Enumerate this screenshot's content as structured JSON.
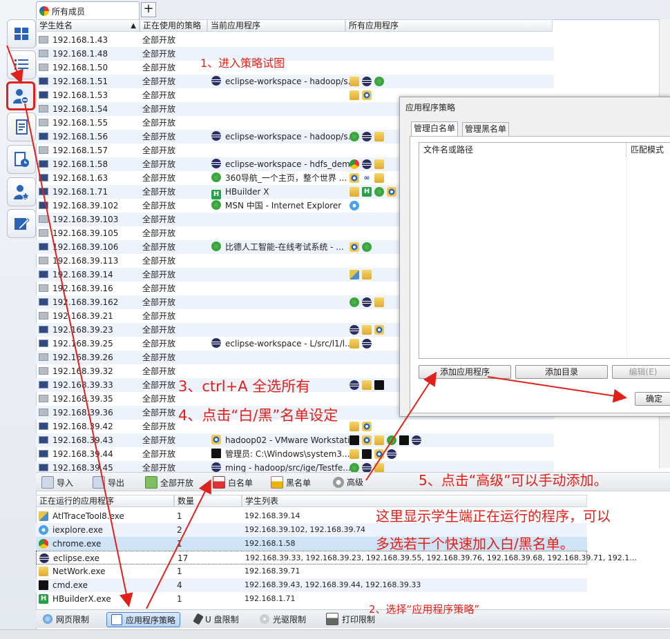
{
  "tabs": {
    "active_label": "所有成员",
    "add_label": "+"
  },
  "table": {
    "headers": [
      "学生姓名",
      "正在使用的策略",
      "当前应用程序",
      "所有应用程序"
    ],
    "rows": [
      {
        "ip": "192.168.1.43",
        "policy": "全部开放",
        "app": "",
        "app_icon": "",
        "all": [],
        "on": false
      },
      {
        "ip": "192.168.1.48",
        "policy": "全部开放",
        "app": "",
        "app_icon": "",
        "all": [],
        "on": false
      },
      {
        "ip": "192.168.1.50",
        "policy": "全部开放",
        "app": "",
        "app_icon": "",
        "all": [],
        "on": false
      },
      {
        "ip": "192.168.1.51",
        "policy": "全部开放",
        "app": "eclipse-workspace - hadoop/s...",
        "app_icon": "eclipse",
        "all": [
          "folder",
          "eclipse",
          "edge"
        ],
        "on": true
      },
      {
        "ip": "192.168.1.53",
        "policy": "全部开放",
        "app": "",
        "app_icon": "",
        "all": [
          "folder",
          "target"
        ],
        "on": true
      },
      {
        "ip": "192.168.1.54",
        "policy": "全部开放",
        "app": "",
        "app_icon": "",
        "all": [],
        "on": false
      },
      {
        "ip": "192.168.1.55",
        "policy": "全部开放",
        "app": "",
        "app_icon": "",
        "all": [],
        "on": false
      },
      {
        "ip": "192.168.1.56",
        "policy": "全部开放",
        "app": "eclipse-workspace - hadoop/s...",
        "app_icon": "eclipse",
        "all": [
          "edge",
          "eclipse",
          "folder"
        ],
        "on": true
      },
      {
        "ip": "192.168.1.57",
        "policy": "全部开放",
        "app": "",
        "app_icon": "",
        "all": [],
        "on": false
      },
      {
        "ip": "192.168.1.58",
        "policy": "全部开放",
        "app": "eclipse-workspace - hdfs_dem...",
        "app_icon": "eclipse",
        "all": [
          "chrome",
          "eclipse",
          "folder"
        ],
        "on": true
      },
      {
        "ip": "192.168.1.63",
        "policy": "全部开放",
        "app": "360导航_一个主页，整个世界 ...",
        "app_icon": "edge",
        "all": [
          "target",
          "infinity",
          "folder"
        ],
        "on": true
      },
      {
        "ip": "192.168.1.71",
        "policy": "全部开放",
        "app": "HBuilder X",
        "app_icon": "hbuilder",
        "all": [
          "folder",
          "hbuilder",
          "edge",
          "target"
        ],
        "on": true
      },
      {
        "ip": "192.168.39.102",
        "policy": "全部开放",
        "app": "MSN 中国 - Internet Explorer",
        "app_icon": "edge",
        "all": [
          "ie"
        ],
        "on": true
      },
      {
        "ip": "192.168.39.103",
        "policy": "全部开放",
        "app": "",
        "app_icon": "",
        "all": [],
        "on": false
      },
      {
        "ip": "192.168.39.105",
        "policy": "全部开放",
        "app": "",
        "app_icon": "",
        "all": [],
        "on": false
      },
      {
        "ip": "192.168.39.106",
        "policy": "全部开放",
        "app": "比德人工智能-在线考试系统 - ...",
        "app_icon": "edge",
        "all": [
          "target",
          "edge"
        ],
        "on": true
      },
      {
        "ip": "192.168.39.113",
        "policy": "全部开放",
        "app": "",
        "app_icon": "",
        "all": [],
        "on": false
      },
      {
        "ip": "192.168.39.14",
        "policy": "全部开放",
        "app": "",
        "app_icon": "",
        "all": [
          "tool",
          "folder"
        ],
        "on": true
      },
      {
        "ip": "192.168.39.16",
        "policy": "全部开放",
        "app": "",
        "app_icon": "",
        "all": [],
        "on": false
      },
      {
        "ip": "192.168.39.162",
        "policy": "全部开放",
        "app": "",
        "app_icon": "",
        "all": [
          "edge",
          "eclipse",
          "folder"
        ],
        "on": true
      },
      {
        "ip": "192.168.39.21",
        "policy": "全部开放",
        "app": "",
        "app_icon": "",
        "all": [],
        "on": false
      },
      {
        "ip": "192.168.39.23",
        "policy": "全部开放",
        "app": "",
        "app_icon": "",
        "all": [
          "eclipse",
          "folder",
          "target"
        ],
        "on": true
      },
      {
        "ip": "192.168.39.25",
        "policy": "全部开放",
        "app": "eclipse-workspace - L/src/l1/l...",
        "app_icon": "eclipse",
        "all": [
          "folder",
          "eclipse"
        ],
        "on": true
      },
      {
        "ip": "192.168.39.26",
        "policy": "全部开放",
        "app": "",
        "app_icon": "",
        "all": [],
        "on": false
      },
      {
        "ip": "192.168.39.32",
        "policy": "全部开放",
        "app": "",
        "app_icon": "",
        "all": [],
        "on": false
      },
      {
        "ip": "192.168.39.33",
        "policy": "全部开放",
        "app": "",
        "app_icon": "",
        "all": [
          "eclipse",
          "folder",
          "cmd"
        ],
        "on": true
      },
      {
        "ip": "192.168.39.35",
        "policy": "全部开放",
        "app": "",
        "app_icon": "",
        "all": [],
        "on": false
      },
      {
        "ip": "192.168.39.36",
        "policy": "全部开放",
        "app": "",
        "app_icon": "",
        "all": [],
        "on": false
      },
      {
        "ip": "192.168.39.42",
        "policy": "全部开放",
        "app": "",
        "app_icon": "",
        "all": [
          "folder",
          "target"
        ],
        "on": true
      },
      {
        "ip": "192.168.39.43",
        "policy": "全部开放",
        "app": "hadoop02 - VMware Workstati...",
        "app_icon": "target",
        "all": [
          "cmd",
          "target",
          "folder",
          "edge",
          "cmd",
          "eclipse"
        ],
        "on": true
      },
      {
        "ip": "192.168.39.44",
        "policy": "全部开放",
        "app": "管理员: C:\\Windows\\system3...",
        "app_icon": "cmd",
        "all": [
          "folder",
          "cmd",
          "target",
          "eclipse"
        ],
        "on": true
      },
      {
        "ip": "192.168.39.45",
        "policy": "全部开放",
        "app": "ming - hadoop/src/ige/Testfe...",
        "app_icon": "eclipse",
        "all": [
          "edge",
          "eclipse",
          "folder"
        ],
        "on": true
      }
    ]
  },
  "toolbar": {
    "import": "导入",
    "export": "导出",
    "open_all": "全部开放",
    "whitelist": "白名单",
    "blacklist": "黑名单",
    "advanced": "高级"
  },
  "running": {
    "headers": [
      "正在运行的应用程序",
      "数量",
      "学生列表"
    ],
    "rows": [
      {
        "name": "AtlTraceTool8.exe",
        "count": "1",
        "students": "192.168.39.14",
        "icon": "tool"
      },
      {
        "name": "iexplore.exe",
        "count": "2",
        "students": "192.168.39.102, 192.168.39.74",
        "icon": "ie"
      },
      {
        "name": "chrome.exe",
        "count": "1",
        "students": "192.168.1.58",
        "icon": "chrome"
      },
      {
        "name": "eclipse.exe",
        "count": "17",
        "students": "192.168.39.33, 192.168.39.23, 192.168.39.55, 192.168.39.76, 192.168.39.68, 192.168.39.71, 192.1...",
        "icon": "eclipse"
      },
      {
        "name": "NetWork.exe",
        "count": "1",
        "students": "192.168.39.71",
        "icon": "network"
      },
      {
        "name": "cmd.exe",
        "count": "4",
        "students": "192.168.39.43, 192.168.39.44, 192.168.39.33",
        "icon": "cmd"
      },
      {
        "name": "HBuilderX.exe",
        "count": "1",
        "students": "192.168.1.71",
        "icon": "hbuilder"
      }
    ]
  },
  "bottom_tabs": [
    "网页限制",
    "应用程序策略",
    "U 盘限制",
    "光驱限制",
    "打印限制"
  ],
  "dialog": {
    "title": "应用程序策略",
    "tab_white": "管理白名单",
    "tab_black": "管理黑名单",
    "col_path": "文件名或路径",
    "col_match": "匹配模式",
    "add_app": "添加应用程序",
    "add_dir": "添加目录",
    "edit": "编辑(E)",
    "ok": "确定"
  },
  "annotations": {
    "a1": "1、进入策略试图",
    "a2": "2、选择“应用程序策略”",
    "a3": "3、ctrl+A 全选所有",
    "a4": "4、点击“白/黑”名单设定",
    "a5": "5、点击“高级”可以手动添加。",
    "a6_line1": "这里显示学生端正在运行的程序，可以",
    "a6_line2": "多选若干个快速加入白/黑名单。"
  },
  "colors": {
    "annotation": "#e0201a",
    "selected_row": "#cfe4f7",
    "alt_row": "#eef3fb"
  }
}
